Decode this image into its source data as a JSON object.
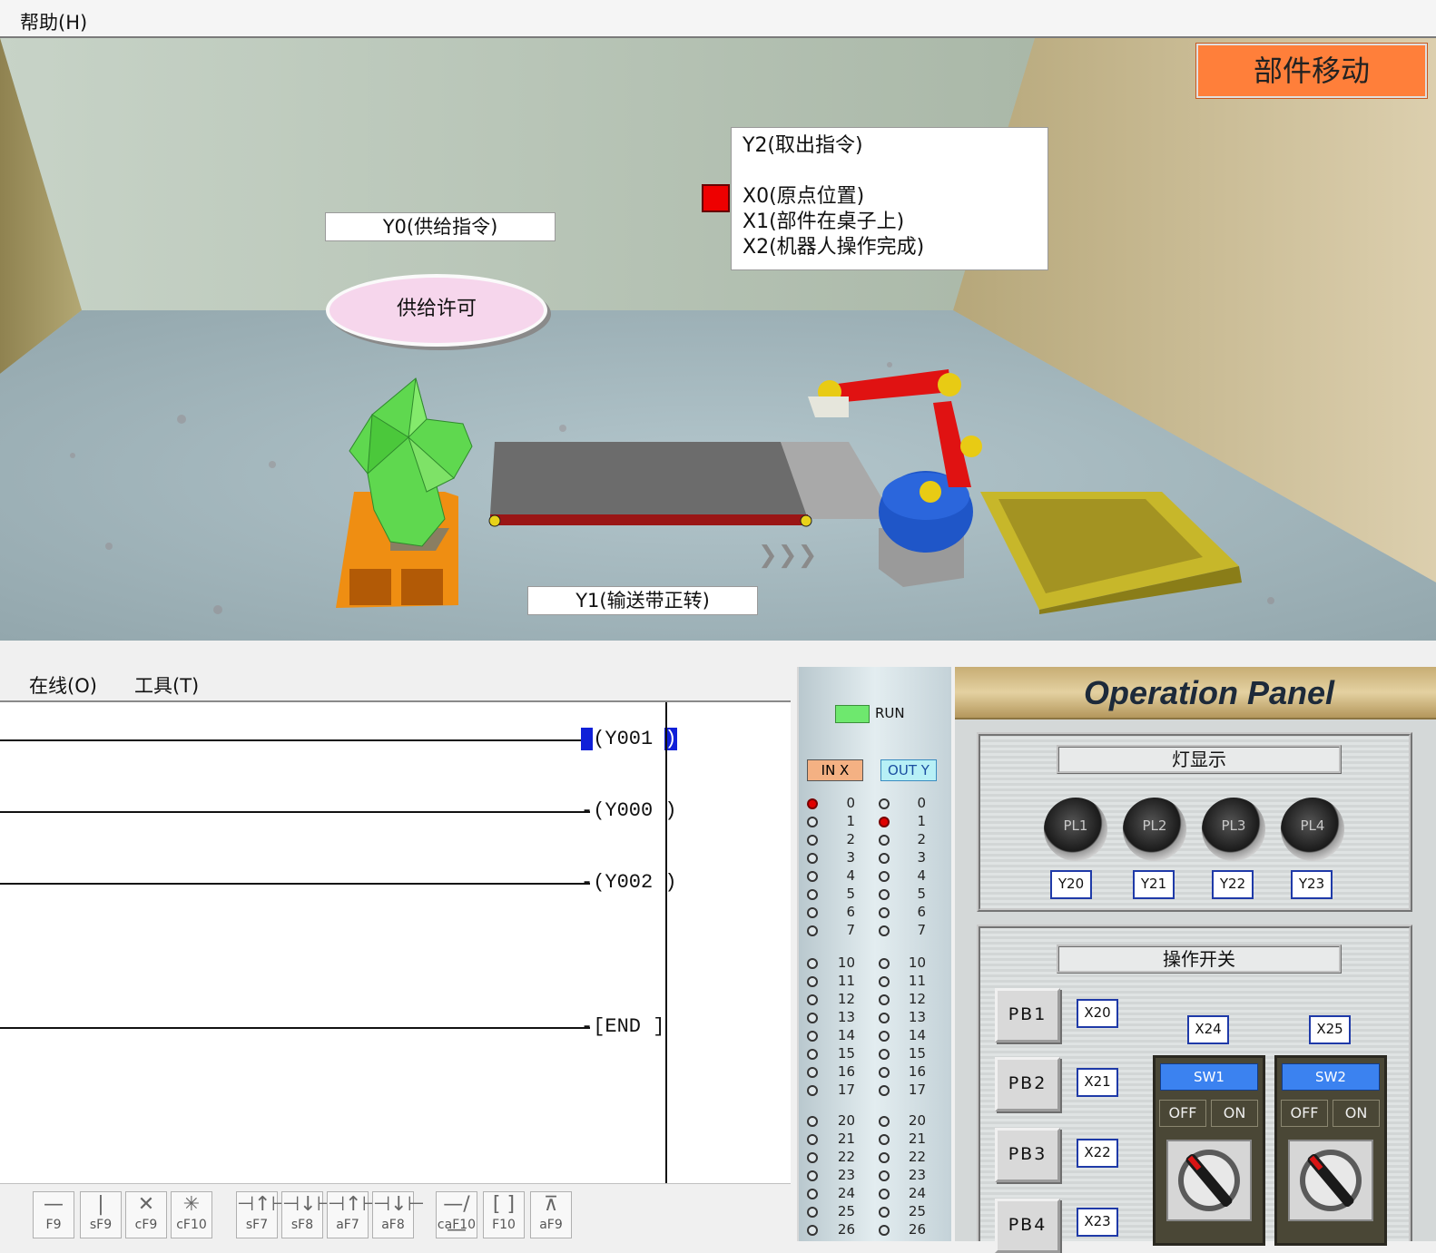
{
  "menu": {
    "help": "帮助(H)"
  },
  "scene": {
    "badge": "部件移动",
    "y0_label": "Y0(供给指令)",
    "supply_button": "供给许可",
    "y1_label": "Y1(输送带正转)",
    "status": {
      "line1": "Y2(取出指令)",
      "line2": "X0(原点位置)",
      "line3": "X1(部件在桌子上)",
      "line4": "X2(机器人操作完成)"
    }
  },
  "ladder": {
    "menu": {
      "online": "在线(O)",
      "tools": "工具(T)"
    },
    "coils": [
      "Y001",
      "Y000",
      "Y002",
      "END"
    ],
    "toolbar": [
      {
        "key": "F9"
      },
      {
        "key": "sF9"
      },
      {
        "key": "cF9"
      },
      {
        "key": "cF10"
      },
      {
        "key": "sF7"
      },
      {
        "key": "sF8"
      },
      {
        "key": "aF7"
      },
      {
        "key": "aF8"
      },
      {
        "key": "caF10"
      },
      {
        "key": "F10"
      },
      {
        "key": "aF9"
      }
    ]
  },
  "io": {
    "run": "RUN",
    "in_header": "IN X",
    "out_header": "OUT Y",
    "numbers": [
      "0",
      "1",
      "2",
      "3",
      "4",
      "5",
      "6",
      "7",
      "10",
      "11",
      "12",
      "13",
      "14",
      "15",
      "16",
      "17",
      "20",
      "21",
      "22",
      "23",
      "24",
      "25",
      "26"
    ],
    "in_on": [
      "0"
    ],
    "out_on": [
      "1"
    ]
  },
  "panel": {
    "title": "Operation Panel",
    "lamp_group": "灯显示",
    "lamps": [
      {
        "name": "PL1",
        "addr": "Y20"
      },
      {
        "name": "PL2",
        "addr": "Y21"
      },
      {
        "name": "PL3",
        "addr": "Y22"
      },
      {
        "name": "PL4",
        "addr": "Y23"
      }
    ],
    "switch_group": "操作开关",
    "buttons": [
      {
        "name": "PB1",
        "addr": "X20"
      },
      {
        "name": "PB2",
        "addr": "X21"
      },
      {
        "name": "PB3",
        "addr": "X22"
      },
      {
        "name": "PB4",
        "addr": "X23"
      }
    ],
    "switches": [
      {
        "name": "SW1",
        "addr": "X24",
        "off": "OFF",
        "on": "ON"
      },
      {
        "name": "SW2",
        "addr": "X25",
        "off": "OFF",
        "on": "ON"
      }
    ]
  },
  "colors": {
    "badge": "#ff7f3a",
    "led_on": "#e00000",
    "run_led": "#6ee86e",
    "switch_label": "#3b82f0"
  }
}
